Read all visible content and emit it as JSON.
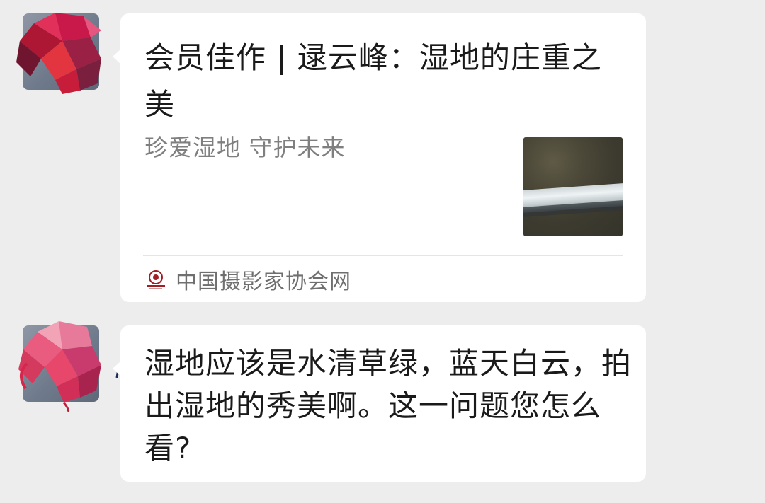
{
  "messages": [
    {
      "type": "article-card",
      "card": {
        "title": "会员佳作 | 逯云峰：湿地的庄重之美",
        "description": "珍爱湿地 守护未来",
        "thumbnail": "wetland-aerial-photo",
        "source_name": "中国摄影家协会网",
        "source_icon": "cpa-logo-icon"
      }
    },
    {
      "type": "text",
      "text": "湿地应该是水清草绿，蓝天白云，拍出湿地的秀美啊。这一问题您怎么看?"
    }
  ],
  "colors": {
    "background": "#ededed",
    "bubble": "#ffffff",
    "title_text": "#1a1a1a",
    "secondary_text": "#7f7f7f",
    "avatar_accent": "#d6264b"
  }
}
